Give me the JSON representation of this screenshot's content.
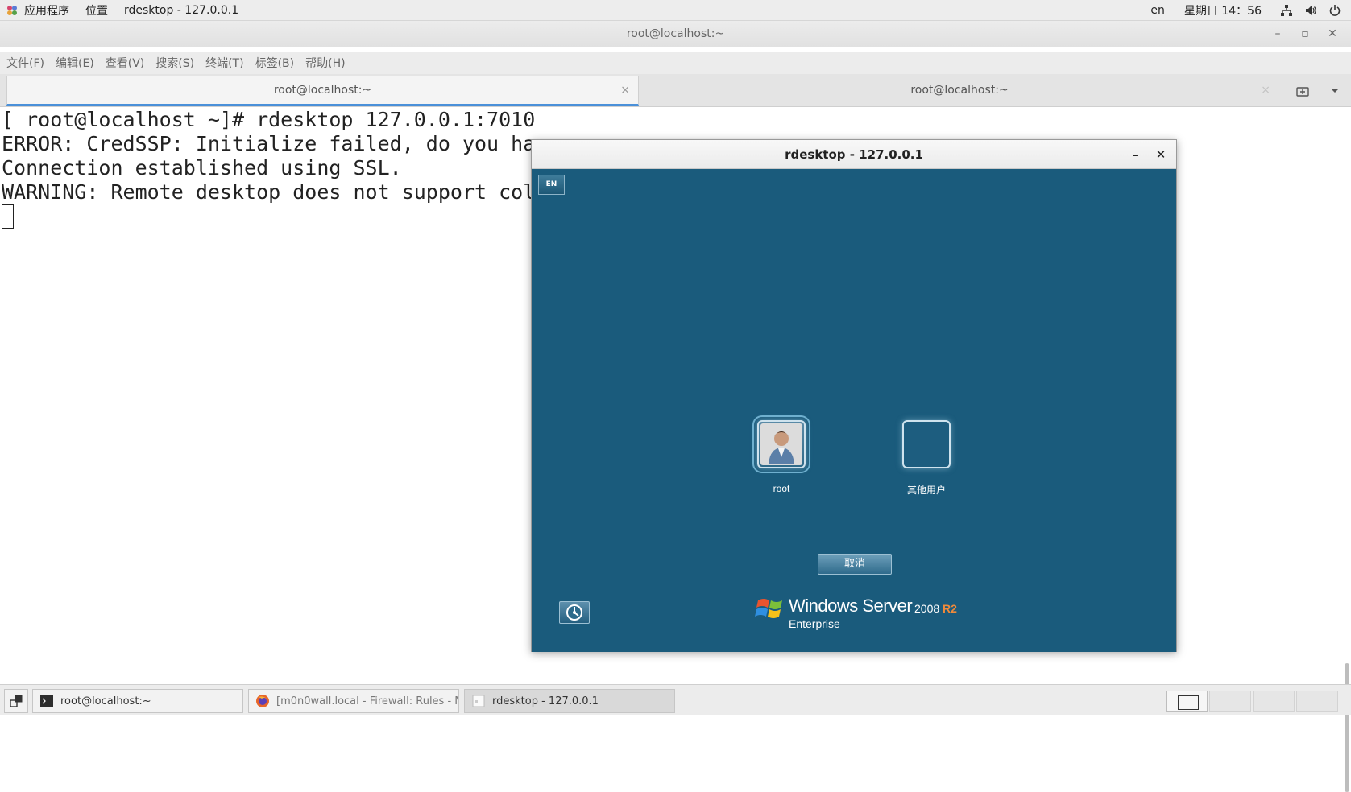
{
  "top_panel": {
    "applications": "应用程序",
    "places": "位置",
    "active_window": "rdesktop - 127.0.0.1",
    "input_lang": "en",
    "clock": "星期日 14：56",
    "icons": [
      "network-icon",
      "volume-icon",
      "power-icon"
    ]
  },
  "terminal_window": {
    "title": "root@localhost:~",
    "controls": {
      "minimize": "–",
      "maximize": "▫",
      "close": "✕"
    },
    "menu": [
      "文件(F)",
      "编辑(E)",
      "查看(V)",
      "搜索(S)",
      "终端(T)",
      "标签(B)",
      "帮助(H)"
    ],
    "tabs": [
      {
        "label": "root@localhost:~",
        "close": "×",
        "active": true
      },
      {
        "label": "root@localhost:~",
        "close": "×",
        "active": false
      }
    ],
    "lines": [
      "[ root@localhost ~]# rdesktop 127.0.0.1:7010",
      "ERROR: CredSSP: Initialize failed, do you ha",
      "Connection established using SSL.",
      "WARNING: Remote desktop does not support col"
    ]
  },
  "rdesktop_window": {
    "title": "rdesktop - 127.0.0.1",
    "controls": {
      "minimize": "–",
      "close": "✕"
    },
    "lang_indicator": "EN",
    "users": [
      {
        "label": "root",
        "selected": true
      },
      {
        "label": "其他用户",
        "selected": false
      }
    ],
    "cancel": "取消",
    "brand": {
      "windows": "Windows Server",
      "version": "2008",
      "r2": "R2",
      "edition": "Enterprise"
    },
    "colors": {
      "background": "#1a5b7c"
    }
  },
  "taskbar": {
    "tasks": [
      {
        "label": "root@localhost:~",
        "icon": "terminal-icon",
        "active": false
      },
      {
        "label": "[m0n0wall.local - Firewall: Rules - M···",
        "icon": "firefox-icon",
        "active": false
      },
      {
        "label": "rdesktop - 127.0.0.1",
        "icon": "window-icon",
        "active": true
      }
    ],
    "workspaces": 4
  }
}
